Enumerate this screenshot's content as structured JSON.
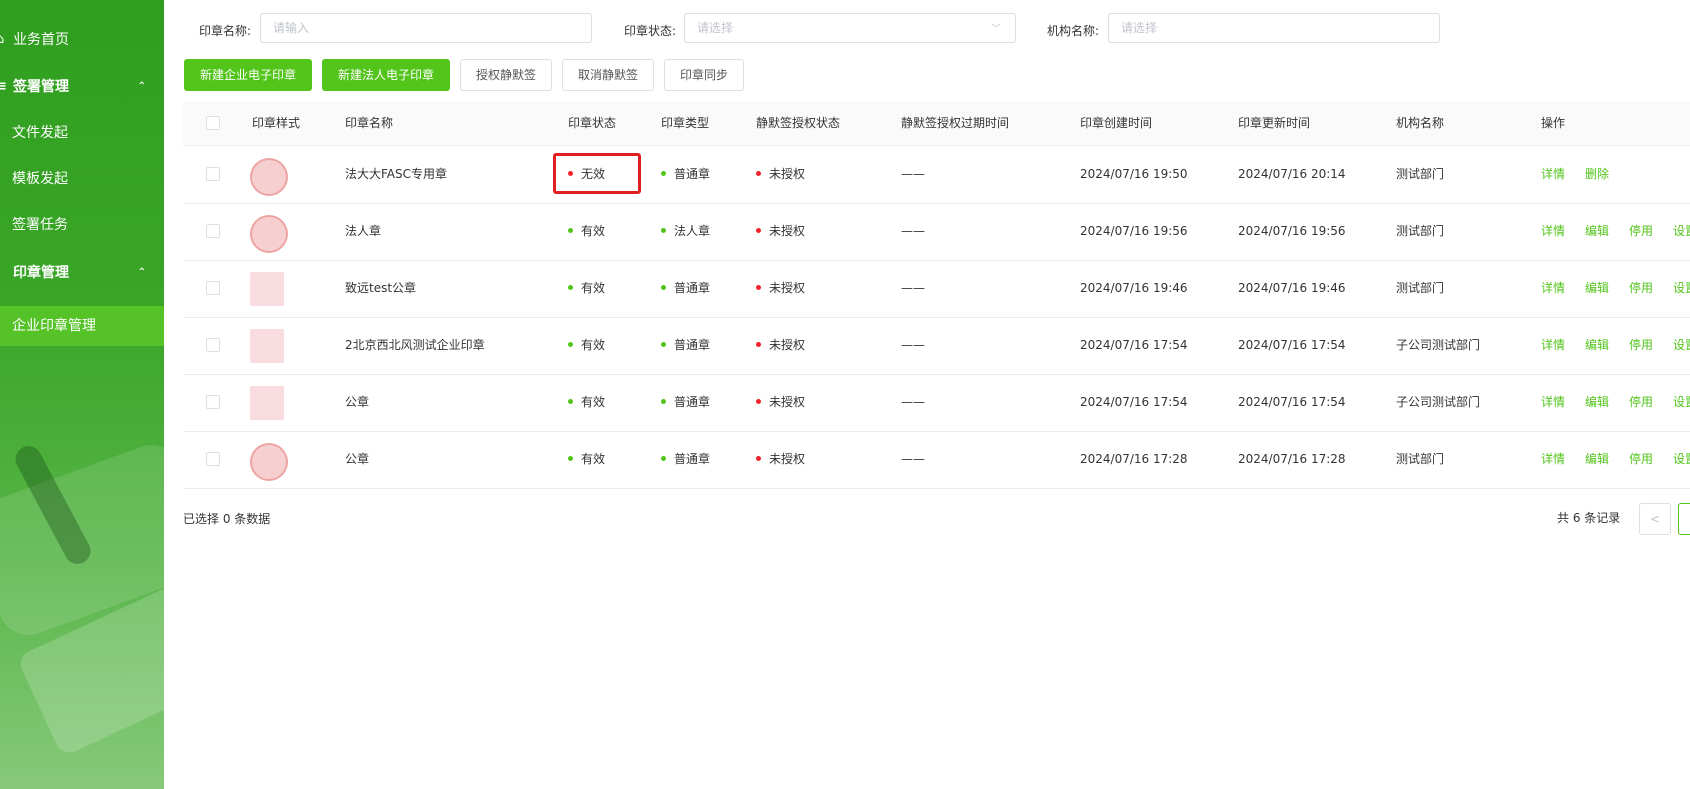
{
  "sidebar": {
    "items": [
      {
        "label": "业务首页",
        "icon": "home-icon",
        "icon_glyph": "⌂"
      },
      {
        "label": "签署管理",
        "icon": "sign-icon",
        "icon_glyph": "≡"
      },
      {
        "label": "文件发起"
      },
      {
        "label": "模板发起"
      },
      {
        "label": "签署任务"
      },
      {
        "label": "印章管理"
      },
      {
        "label": "企业印章管理"
      }
    ],
    "arrow_glyph": "⌃"
  },
  "filters": {
    "name_label": "印章名称:",
    "name_placeholder": "请输入",
    "status_label": "印章状态:",
    "status_placeholder": "请选择",
    "org_label": "机构名称:",
    "org_placeholder": "请选择",
    "chevron_glyph": "﹀"
  },
  "toolbar": {
    "new_company_seal": "新建企业电子印章",
    "new_legal_seal": "新建法人电子印章",
    "authorize_silent": "授权静默签",
    "cancel_silent": "取消静默签",
    "seal_sync": "印章同步"
  },
  "table": {
    "headers": {
      "style": "印章样式",
      "name": "印章名称",
      "status": "印章状态",
      "type": "印章类型",
      "silent_status": "静默签授权状态",
      "silent_expire": "静默签授权过期时间",
      "created": "印章创建时间",
      "updated": "印章更新时间",
      "org": "机构名称",
      "ops": "操作"
    },
    "rows": [
      {
        "name": "法大大FASC专用章",
        "status": "无效",
        "type": "普通章",
        "silent_status": "未授权",
        "silent_expire": "——",
        "created": "2024/07/16 19:50",
        "updated": "2024/07/16 20:14",
        "org": "测试部门",
        "op1": "详情",
        "op2": "删除",
        "op3": "",
        "op4": ""
      },
      {
        "name": "法人章",
        "status": "有效",
        "type": "法人章",
        "silent_status": "未授权",
        "silent_expire": "——",
        "created": "2024/07/16 19:56",
        "updated": "2024/07/16 19:56",
        "org": "测试部门",
        "op1": "详情",
        "op2": "编辑",
        "op3": "停用",
        "op4": "设置"
      },
      {
        "name": "致远test公章",
        "status": "有效",
        "type": "普通章",
        "silent_status": "未授权",
        "silent_expire": "——",
        "created": "2024/07/16 19:46",
        "updated": "2024/07/16 19:46",
        "org": "测试部门",
        "op1": "详情",
        "op2": "编辑",
        "op3": "停用",
        "op4": "设置"
      },
      {
        "name": "2北京西北风测试企业印章",
        "status": "有效",
        "type": "普通章",
        "silent_status": "未授权",
        "silent_expire": "——",
        "created": "2024/07/16 17:54",
        "updated": "2024/07/16 17:54",
        "org": "子公司测试部门",
        "op1": "详情",
        "op2": "编辑",
        "op3": "停用",
        "op4": "设置"
      },
      {
        "name": "公章",
        "status": "有效",
        "type": "普通章",
        "silent_status": "未授权",
        "silent_expire": "——",
        "created": "2024/07/16 17:54",
        "updated": "2024/07/16 17:54",
        "org": "子公司测试部门",
        "op1": "详情",
        "op2": "编辑",
        "op3": "停用",
        "op4": "设置"
      },
      {
        "name": "公章",
        "status": "有效",
        "type": "普通章",
        "silent_status": "未授权",
        "silent_expire": "——",
        "created": "2024/07/16 17:28",
        "updated": "2024/07/16 17:28",
        "org": "测试部门",
        "op1": "详情",
        "op2": "编辑",
        "op3": "停用",
        "op4": "设置"
      }
    ]
  },
  "footer": {
    "selected_text": "已选择 0 条数据",
    "total_text": "共 6 条记录",
    "prev_glyph": "<"
  },
  "colors": {
    "accent": "#52c41a",
    "valid": "#52c41a",
    "invalid": "#f5222d",
    "highlight": "#e02020"
  }
}
